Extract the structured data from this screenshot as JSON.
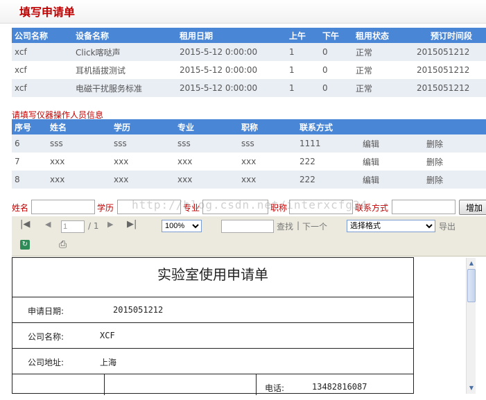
{
  "page": {
    "title": "填写申请单"
  },
  "equipment_table": {
    "headers": [
      "公司名称",
      "设备名称",
      "租用日期",
      "上午",
      "下午",
      "租用状态",
      "预订时间段"
    ],
    "rows": [
      [
        "xcf",
        "Click喀哒声",
        "2015-5-12 0:00:00",
        "1",
        "0",
        "正常",
        "2015051212"
      ],
      [
        "xcf",
        "耳机插拔测试",
        "2015-5-12 0:00:00",
        "1",
        "0",
        "正常",
        "2015051212"
      ],
      [
        "xcf",
        "电磁干扰服务标准",
        "2015-5-12 0:00:00",
        "1",
        "0",
        "正常",
        "2015051212"
      ]
    ]
  },
  "operators": {
    "section_label": "请填写仪器操作人员信息",
    "headers": [
      "序号",
      "姓名",
      "学历",
      "专业",
      "职称",
      "联系方式",
      "",
      ""
    ],
    "rows": [
      [
        "6",
        "sss",
        "sss",
        "sss",
        "sss",
        "1111",
        "编辑",
        "删除"
      ],
      [
        "7",
        "xxx",
        "xxx",
        "xxx",
        "xxx",
        "222",
        "编辑",
        "删除"
      ],
      [
        "8",
        "xxx",
        "xxx",
        "xxx",
        "xxx",
        "222",
        "编辑",
        "删除"
      ]
    ]
  },
  "form": {
    "name_label": "姓名",
    "edu_label": "学历",
    "major_label": "专业",
    "title_label": "职称",
    "contact_label": "联系方式",
    "add_button": "增加"
  },
  "watermark": "http://blog.csdn.net/interxcfg34",
  "viewer": {
    "page_value": "1",
    "page_total": "/ 1",
    "zoom": "100%",
    "find_label": "查找",
    "separator": "|",
    "next_label": "下一个",
    "format_select": "选择格式",
    "export_label": "导出",
    "icons": [
      "first-page-icon",
      "prev-page-icon",
      "next-page-icon",
      "last-page-icon",
      "refresh-icon",
      "print-icon"
    ]
  },
  "report": {
    "title": "实验室使用申请单",
    "date_label": "申请日期:",
    "date_value": "2015051212",
    "company_label": "公司名称:",
    "company_value": "XCF",
    "address_label": "公司地址:",
    "address_value": "上海",
    "phone_label": "电话:",
    "phone_value": "13482816087"
  },
  "colors": {
    "header_blue": "#4a86d6",
    "title_red": "#c00000",
    "row_alt": "#e9edf4",
    "toolbar_bg": "#eceadf"
  }
}
